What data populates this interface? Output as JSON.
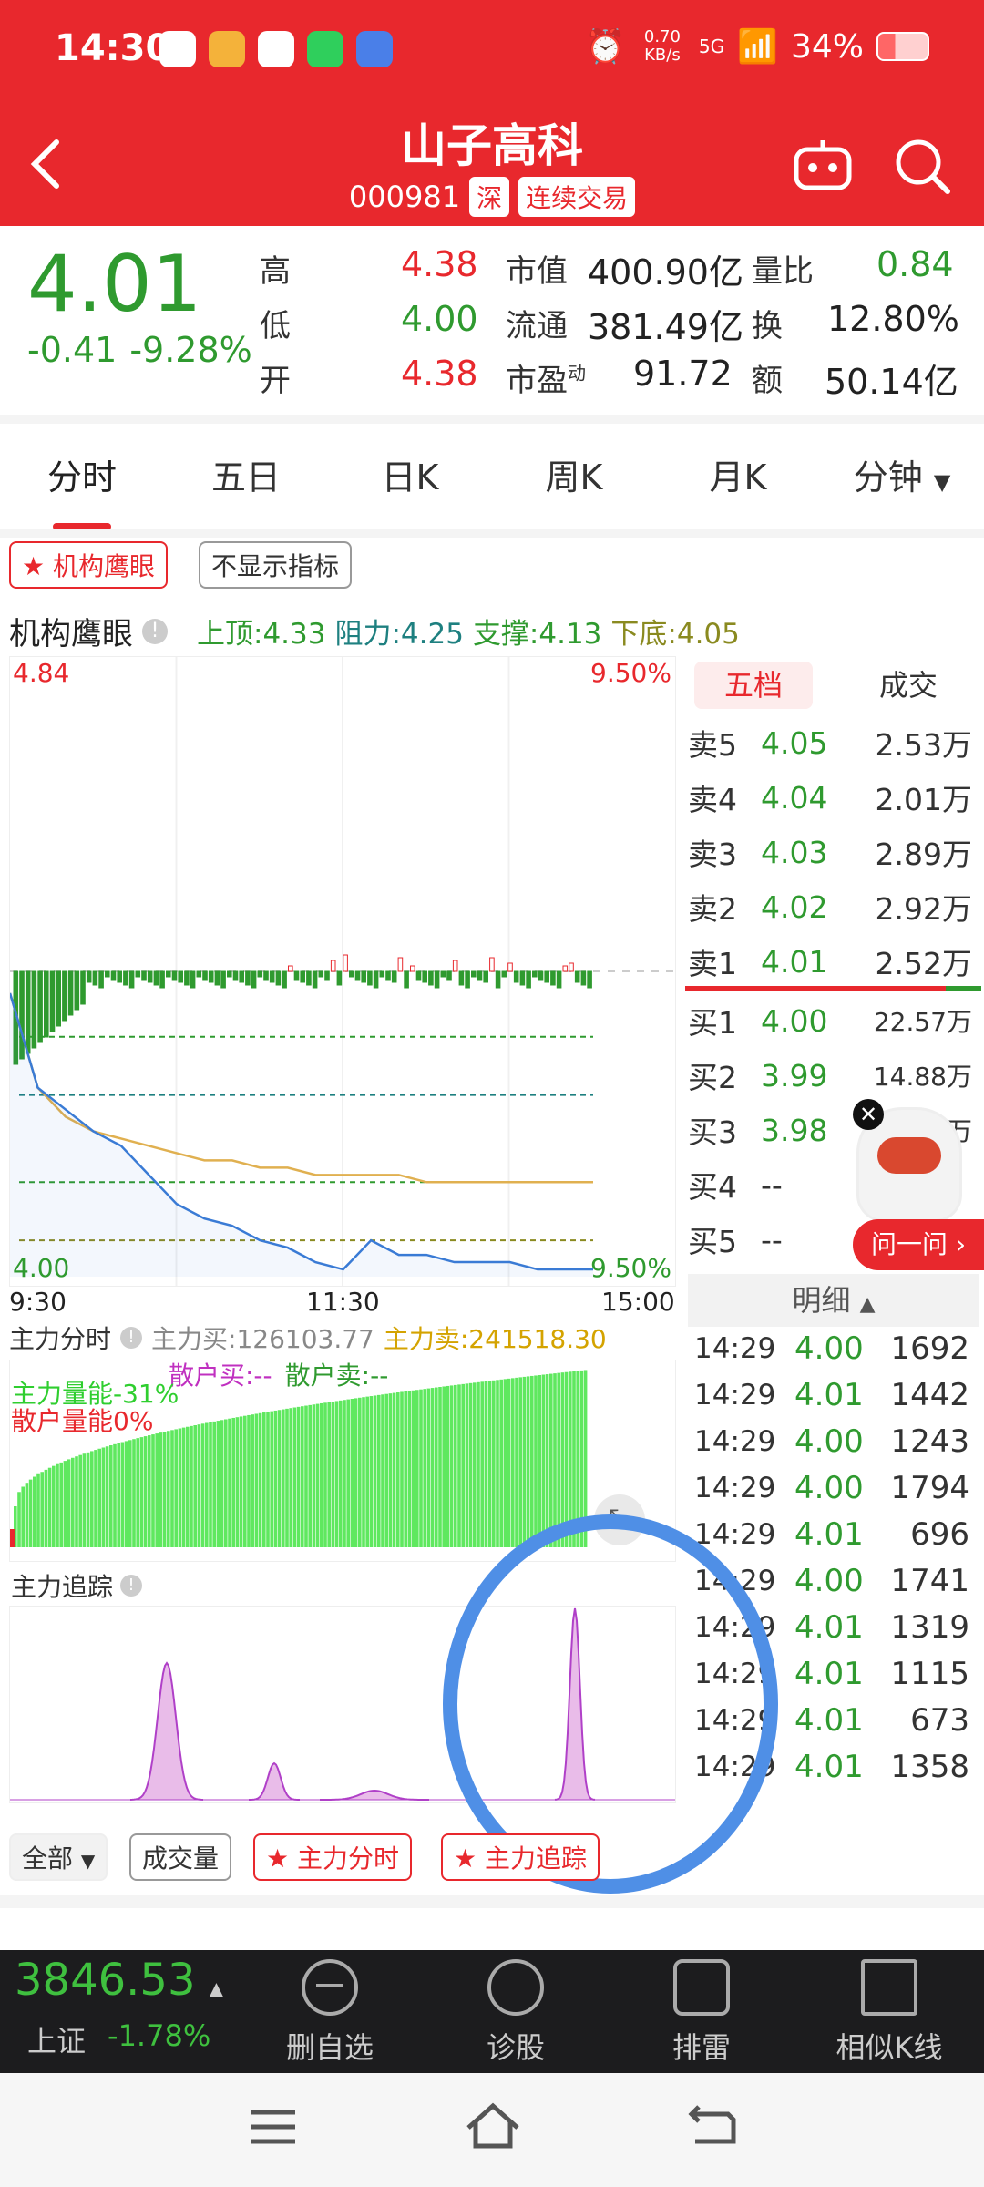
{
  "status_bar": {
    "time": "14:30",
    "speed": "0.70 KB/s",
    "network": "5G",
    "battery": "34%"
  },
  "header": {
    "title": "山子高科",
    "code": "000981",
    "market_tag": "深",
    "status_tag": "连续交易"
  },
  "quote": {
    "price": "4.01",
    "change": "-0.41",
    "change_pct": "-9.28%",
    "high_label": "高",
    "high": "4.38",
    "low_label": "低",
    "low": "4.00",
    "open_label": "开",
    "open": "4.38",
    "mktcap_label": "市值",
    "mktcap": "400.90亿",
    "float_label": "流通",
    "float": "381.49亿",
    "pe_label": "市盈",
    "pe_sup": "动",
    "pe": "91.72",
    "volratio_label": "量比",
    "volratio": "0.84",
    "turnover_label": "换",
    "turnover": "12.80%",
    "amount_label": "额",
    "amount": "50.14亿"
  },
  "tabs": [
    "分时",
    "五日",
    "日K",
    "周K",
    "月K",
    "分钟"
  ],
  "indicator_chips": {
    "main": "机构鹰眼",
    "hide": "不显示指标"
  },
  "eagle": {
    "label": "机构鹰眼",
    "top": "上顶:4.33",
    "resist": "阻力:4.25",
    "support": "支撑:4.13",
    "bottom": "下底:4.05"
  },
  "chart": {
    "y_top": "4.84",
    "y_bottom": "4.00",
    "pct_top": "9.50%",
    "pct_bottom": "9.50%",
    "x_start": "9:30",
    "x_mid": "11:30",
    "x_end": "15:00"
  },
  "chart_data": {
    "type": "line",
    "x_labels": [
      "9:30",
      "11:30",
      "15:00"
    ],
    "ylim": [
      4.0,
      4.84
    ],
    "series": [
      {
        "values": [
          4.39,
          4.26,
          4.23,
          4.2,
          4.18,
          4.14,
          4.1,
          4.08,
          4.07,
          4.05,
          4.04,
          4.02,
          4.01,
          4.05,
          4.03,
          4.03,
          4.02,
          4.02,
          4.02,
          4.01,
          4.01,
          4.01
        ]
      },
      {
        "values": [
          4.39,
          4.26,
          4.22,
          4.2,
          4.19,
          4.18,
          4.17,
          4.16,
          4.16,
          4.15,
          4.15,
          4.14,
          4.14,
          4.14,
          4.14,
          4.13,
          4.13,
          4.13,
          4.13,
          4.13,
          4.13,
          4.13
        ]
      }
    ]
  },
  "orderbook": {
    "tab_five": "五档",
    "tab_deal": "成交",
    "sells": [
      {
        "name": "卖5",
        "price": "4.05",
        "vol": "2.53万"
      },
      {
        "name": "卖4",
        "price": "4.04",
        "vol": "2.01万"
      },
      {
        "name": "卖3",
        "price": "4.03",
        "vol": "2.89万"
      },
      {
        "name": "卖2",
        "price": "4.02",
        "vol": "2.92万"
      },
      {
        "name": "卖1",
        "price": "4.01",
        "vol": "2.52万"
      }
    ],
    "buys": [
      {
        "name": "买1",
        "price": "4.00",
        "vol": "22.57万"
      },
      {
        "name": "买2",
        "price": "3.99",
        "vol": "14.88万"
      },
      {
        "name": "买3",
        "price": "3.98",
        "vol": "50.74万"
      },
      {
        "name": "买4",
        "price": "--",
        "vol": ""
      },
      {
        "name": "买5",
        "price": "--",
        "vol": ""
      }
    ]
  },
  "ask_button": "问一问 ›",
  "detail": {
    "header": "明细",
    "rows": [
      {
        "t": "14:29",
        "p": "4.00",
        "v": "1692"
      },
      {
        "t": "14:29",
        "p": "4.01",
        "v": "1442"
      },
      {
        "t": "14:29",
        "p": "4.00",
        "v": "1243"
      },
      {
        "t": "14:29",
        "p": "4.00",
        "v": "1794"
      },
      {
        "t": "14:29",
        "p": "4.01",
        "v": "696"
      },
      {
        "t": "14:29",
        "p": "4.00",
        "v": "1741"
      },
      {
        "t": "14:29",
        "p": "4.01",
        "v": "1319"
      },
      {
        "t": "14:29",
        "p": "4.01",
        "v": "1115"
      },
      {
        "t": "14:29",
        "p": "4.01",
        "v": "673"
      },
      {
        "t": "14:29",
        "p": "4.01",
        "v": "1358"
      }
    ]
  },
  "capital": {
    "label": "主力分时",
    "buy": "主力买:126103.77",
    "sell": "主力卖:241518.30",
    "retail_buy": "散户买:--",
    "retail_sell": "散户卖:--",
    "main_energy": "主力量能-31%",
    "retail_energy": "散户量能0%"
  },
  "tracking": {
    "label": "主力追踪"
  },
  "bottom_chips": {
    "all": "全部",
    "volume": "成交量",
    "capital": "主力分时",
    "tracking": "主力追踪"
  },
  "index": {
    "value": "3846.53",
    "name": "上证",
    "pct": "-1.78%"
  },
  "bottom_actions": [
    "删自选",
    "诊股",
    "排雷",
    "相似K线"
  ],
  "colors": {
    "brand_red": "#e8282d",
    "down_green": "#2f9a2f",
    "line_blue": "#3a7bd5",
    "avg_orange": "#e0b050"
  }
}
